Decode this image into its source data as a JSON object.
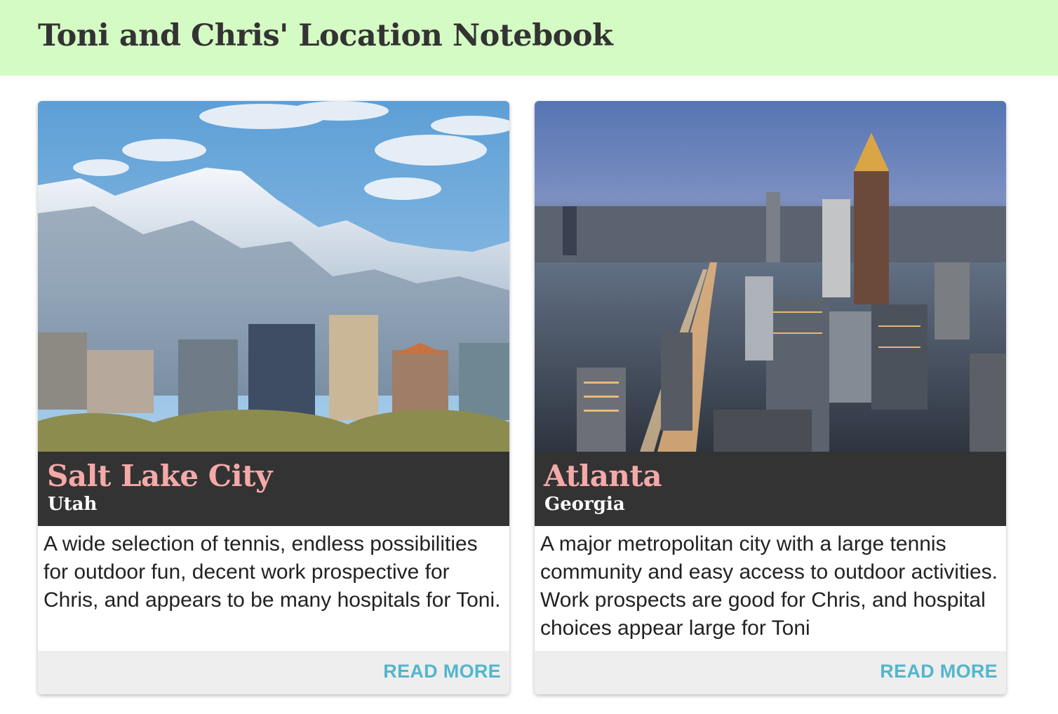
{
  "header": {
    "title": "Toni and Chris' Location Notebook"
  },
  "colors": {
    "header_bg": "#d5fbc4",
    "caption_bg": "#333333",
    "city_name": "#f4a9a8",
    "link": "#53b6cc",
    "actions_bg": "#eeeeee"
  },
  "cards": [
    {
      "image": "salt-lake-city-skyline-with-snowy-mountains",
      "city": "Salt Lake City",
      "state": "Utah",
      "description": "A wide selection of tennis, endless possibilities for outdoor fun, decent work prospective for Chris, and appears to be many hospitals for Toni.",
      "action": "READ MORE"
    },
    {
      "image": "atlanta-aerial-skyline-at-dusk",
      "city": "Atlanta",
      "state": "Georgia",
      "description": "A major metropolitan city with a large tennis community and easy access to outdoor activities. Work prospects are good for Chris, and hospital choices appear large for Toni",
      "action": "READ MORE"
    }
  ]
}
